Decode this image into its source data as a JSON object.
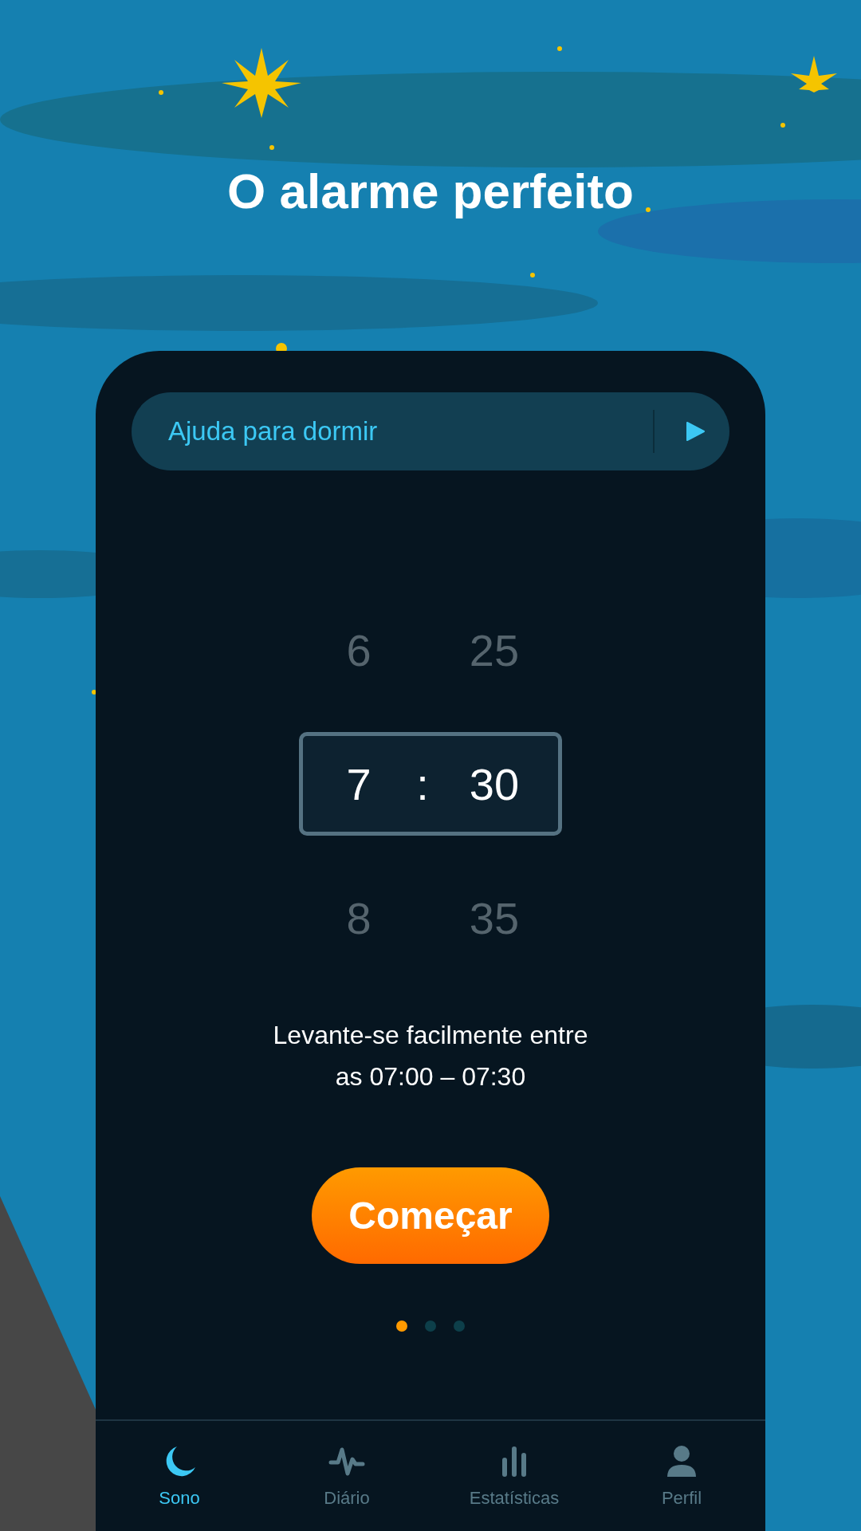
{
  "title": "O alarme perfeito",
  "sleep_aid": {
    "label": "Ajuda para dormir"
  },
  "time_picker": {
    "separator": ":",
    "rows": [
      {
        "hour": "6",
        "minute": "25",
        "selected": false
      },
      {
        "hour": "7",
        "minute": "30",
        "selected": true
      },
      {
        "hour": "8",
        "minute": "35",
        "selected": false
      }
    ]
  },
  "caption_lines": [
    "Levante-se facilmente entre",
    "as 07:00 – 07:30"
  ],
  "start_button": "Começar",
  "page_dots": [
    {
      "selected": true
    },
    {
      "selected": false
    },
    {
      "selected": false
    }
  ],
  "tabs": [
    {
      "kind": "moon",
      "label": "Sono",
      "selected": true
    },
    {
      "kind": "wave",
      "label": "Diário",
      "selected": false
    },
    {
      "kind": "bars",
      "label": "Estatísticas",
      "selected": false
    },
    {
      "kind": "person",
      "label": "Perfil",
      "selected": false
    }
  ]
}
